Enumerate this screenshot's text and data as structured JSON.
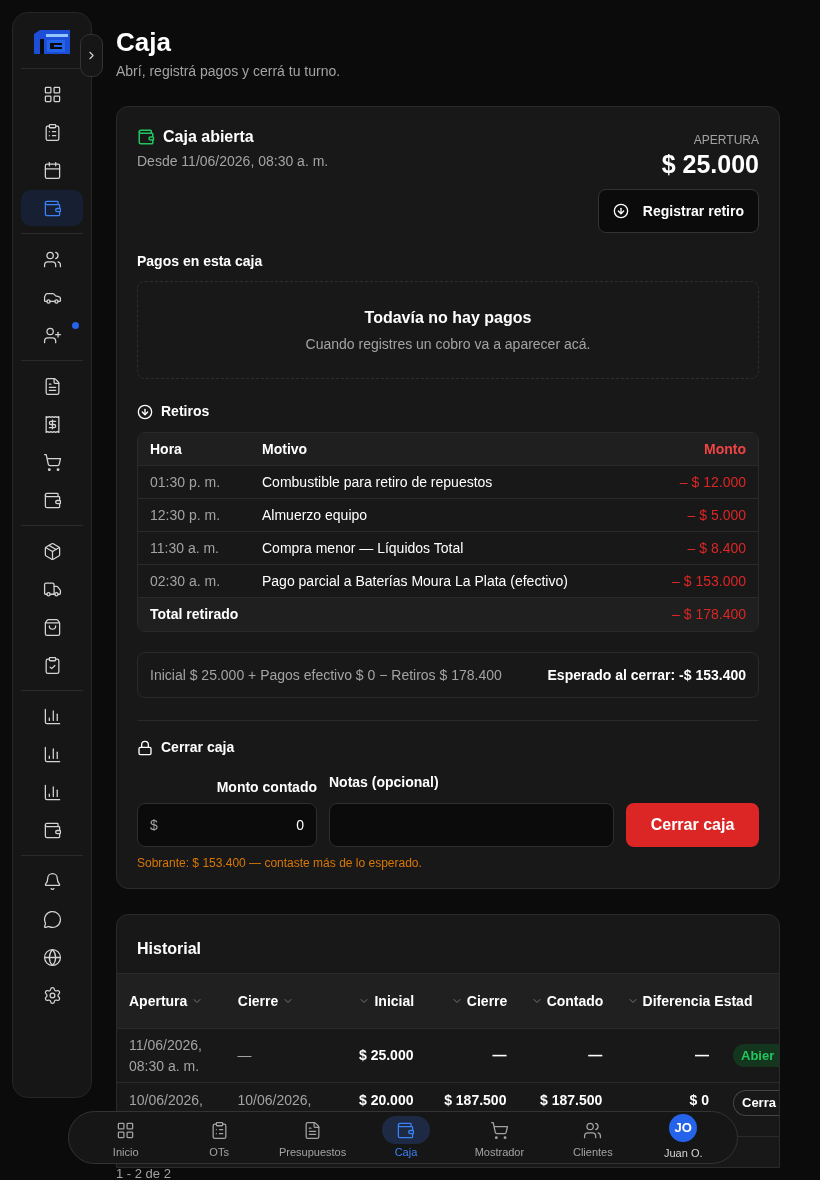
{
  "page": {
    "title": "Caja",
    "subtitle": "Abrí, registrá pagos y cerrá tu turno."
  },
  "sidebar": {
    "groups": [
      {
        "items": [
          {
            "selected": false,
            "notification": false
          },
          {
            "selected": false,
            "notification": false
          },
          {
            "selected": false,
            "notification": false
          },
          {
            "selected": true,
            "notification": false
          }
        ]
      },
      {
        "items": [
          {
            "selected": false,
            "notification": false
          },
          {
            "selected": false,
            "notification": false
          },
          {
            "selected": false,
            "notification": true
          }
        ]
      },
      {
        "items": [
          {
            "selected": false,
            "notification": false
          },
          {
            "selected": false,
            "notification": false
          },
          {
            "selected": false,
            "notification": false
          },
          {
            "selected": false,
            "notification": false
          }
        ]
      },
      {
        "items": [
          {
            "selected": false,
            "notification": false
          },
          {
            "selected": false,
            "notification": false
          },
          {
            "selected": false,
            "notification": false
          },
          {
            "selected": false,
            "notification": false
          }
        ]
      },
      {
        "items": [
          {
            "selected": false,
            "notification": false
          },
          {
            "selected": false,
            "notification": false
          },
          {
            "selected": false,
            "notification": false
          },
          {
            "selected": false,
            "notification": false
          }
        ]
      },
      {
        "items": [
          {
            "selected": false,
            "notification": false
          },
          {
            "selected": false,
            "notification": false
          },
          {
            "selected": false,
            "notification": false
          },
          {
            "selected": false,
            "notification": false
          }
        ]
      }
    ]
  },
  "register": {
    "title": "Caja abierta",
    "since": "Desde 11/06/2026, 08:30 a. m.",
    "opening_label": "APERTURA",
    "opening_amount": "$ 25.000",
    "withdraw_button": "Registrar retiro",
    "payments": {
      "title": "Pagos en esta caja",
      "empty_title": "Todavía no hay pagos",
      "empty_text": "Cuando registres un cobro va a aparecer acá."
    },
    "withdrawals": {
      "title": "Retiros",
      "columns": [
        "Hora",
        "Motivo",
        "Monto"
      ],
      "rows": [
        {
          "time": "01:30 p. m.",
          "reason": "Combustible para retiro de repuestos",
          "amount": "– $ 12.000"
        },
        {
          "time": "12:30 p. m.",
          "reason": "Almuerzo equipo",
          "amount": "– $ 5.000"
        },
        {
          "time": "11:30 a. m.",
          "reason": "Compra menor — Líquidos Total",
          "amount": "– $ 8.400"
        },
        {
          "time": "02:30 a. m.",
          "reason": "Pago parcial a Baterías Moura La Plata (efectivo)",
          "amount": "– $ 153.000"
        }
      ],
      "total_label": "Total retirado",
      "total_amount": "– $ 178.400"
    },
    "summary": {
      "formula": "Inicial $ 25.000 + Pagos efectivo $ 0 − Retiros $ 178.400",
      "expected": "Esperado al cerrar: -$ 153.400"
    },
    "close": {
      "title": "Cerrar caja",
      "amount_label": "Monto contado",
      "currency": "$",
      "amount_value": "0",
      "notes_label": "Notas (opcional)",
      "button": "Cerrar caja",
      "message": "Sobrante: $ 153.400 — contaste más de lo esperado."
    }
  },
  "history": {
    "title": "Historial",
    "columns": [
      {
        "label": "Apertura",
        "sortable": true,
        "kind": "date"
      },
      {
        "label": "Cierre",
        "sortable": true,
        "kind": "date"
      },
      {
        "label": "Inicial",
        "sortable": true,
        "kind": "amount"
      },
      {
        "label": "Cierre",
        "sortable": true,
        "kind": "amount"
      },
      {
        "label": "Contado",
        "sortable": true,
        "kind": "amount"
      },
      {
        "label": "Diferencia",
        "sortable": true,
        "kind": "amount"
      },
      {
        "label": "Estad",
        "sortable": false,
        "kind": "status"
      }
    ],
    "rows": [
      {
        "opened": [
          "11/06/2026,",
          "08:30 a. m."
        ],
        "closed": [
          "—"
        ],
        "initial": "$ 25.000",
        "closing": "—",
        "counted": "—",
        "difference": "—",
        "status": {
          "label": "Abier",
          "kind": "open"
        }
      },
      {
        "opened": [
          "10/06/2026,"
        ],
        "closed": [
          "10/06/2026,"
        ],
        "initial": "$ 20.000",
        "closing": "$ 187.500",
        "counted": "$ 187.500",
        "difference": "$ 0",
        "status": {
          "label": "Cerra",
          "kind": "closed"
        }
      }
    ]
  },
  "pagination": "1 - 2 de 2",
  "bottom_nav": [
    {
      "kind": "icon",
      "label": "Inicio",
      "selected": false
    },
    {
      "kind": "icon",
      "label": "OTs",
      "selected": false
    },
    {
      "kind": "icon",
      "label": "Presupuestos",
      "selected": false
    },
    {
      "kind": "icon",
      "label": "Caja",
      "selected": true
    },
    {
      "kind": "icon",
      "label": "Mostrador",
      "selected": false
    },
    {
      "kind": "icon",
      "label": "Clientes",
      "selected": false
    },
    {
      "kind": "avatar",
      "initials": "JO",
      "label": "Juan O.",
      "selected": false
    }
  ]
}
